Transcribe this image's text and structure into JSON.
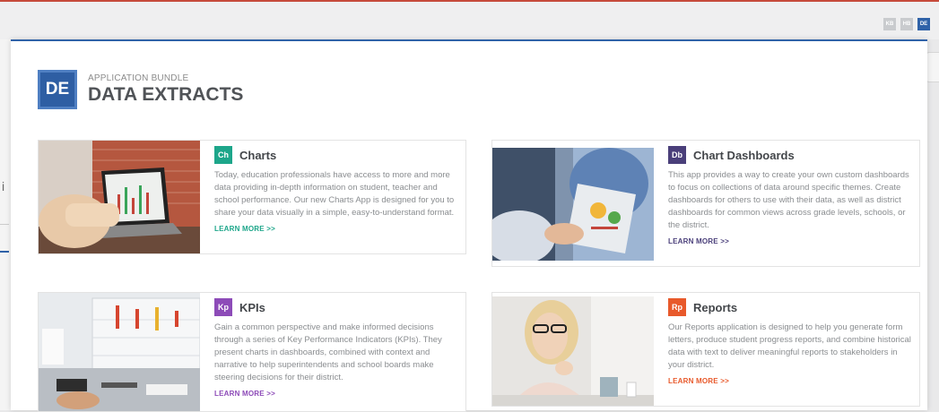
{
  "header": {
    "icons": [
      {
        "label": "KB",
        "icon": "kb-icon",
        "color": "#c9cbce"
      },
      {
        "label": "HB",
        "icon": "hb-icon",
        "color": "#c9cbce"
      },
      {
        "label": "DE",
        "icon": "de-icon",
        "color": "#2f62a8"
      }
    ]
  },
  "side": {
    "char": "i"
  },
  "brand": {
    "badge": "DE",
    "subtitle": "APPLICATION BUNDLE",
    "title": "DATA EXTRACTS"
  },
  "cards": [
    {
      "abbr": "Ch",
      "title": "Charts",
      "color": "#1da68a",
      "desc": "Today, education professionals have access to more and more data providing in-depth information on student, teacher and school performance. Our new Charts App is designed for you to share your data visually in a simple, easy-to-understand format.",
      "learn": "LEARN MORE >>"
    },
    {
      "abbr": "Db",
      "title": "Chart Dashboards",
      "color": "#4a3f7a",
      "desc": "This app provides a way to create your own custom dashboards to focus on collections of data around specific themes. Create dashboards for others to use with their data, as well as district dashboards for common views across grade levels, schools, or the district.",
      "learn": "LEARN MORE >>"
    },
    {
      "abbr": "Kp",
      "title": "KPIs",
      "color": "#8d4bb8",
      "desc": "Gain a common perspective and make informed decisions through a series of Key Performance Indicators (KPIs). They present charts in dashboards, combined with context and narrative to help superintendents and school boards make steering decisions for their district.",
      "learn": "LEARN MORE >>"
    },
    {
      "abbr": "Rp",
      "title": "Reports",
      "color": "#e8592b",
      "desc": "Our Reports application is designed to help you generate form letters, produce student progress reports, and combine historical data with text to deliver meaningful reports to stakeholders in your district.",
      "learn": "LEARN MORE >>"
    }
  ]
}
